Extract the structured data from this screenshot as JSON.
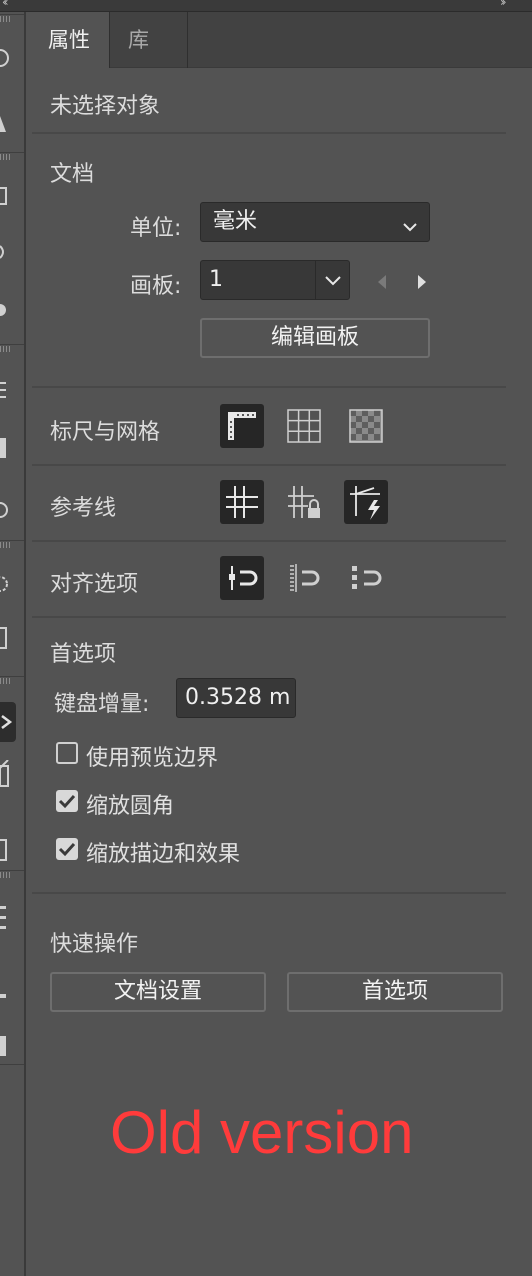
{
  "tabs": [
    {
      "label": "属性",
      "active": true
    },
    {
      "label": "库",
      "active": false
    }
  ],
  "selection_status": "未选择对象",
  "document": {
    "heading": "文档",
    "units_label": "单位:",
    "units_value": "毫米",
    "artboard_label": "画板:",
    "artboard_value": "1",
    "edit_artboards_button": "编辑画板"
  },
  "rulers_grids": {
    "label": "标尺与网格",
    "icons": [
      "ruler-icon",
      "grid-icon",
      "transparency-grid-icon"
    ],
    "active": [
      true,
      false,
      false
    ]
  },
  "guides": {
    "label": "参考线",
    "icons": [
      "guides-icon",
      "lock-guides-icon",
      "smart-guides-icon"
    ],
    "active": [
      true,
      false,
      true
    ]
  },
  "snap_options": {
    "label": "对齐选项",
    "icons": [
      "snap-to-point-icon",
      "snap-to-pixel-icon",
      "snap-to-glyph-icon"
    ],
    "active": [
      true,
      false,
      false
    ]
  },
  "preferences": {
    "heading": "首选项",
    "keyboard_increment_label": "键盘增量:",
    "keyboard_increment_value": "0.3528 m",
    "checkboxes": [
      {
        "label": "使用预览边界",
        "checked": false
      },
      {
        "label": "缩放圆角",
        "checked": true
      },
      {
        "label": "缩放描边和效果",
        "checked": true
      }
    ]
  },
  "quick_actions": {
    "heading": "快速操作",
    "document_setup_button": "文档设置",
    "preferences_button": "首选项"
  },
  "annotation": {
    "text": "Old version",
    "color": "#ff3b3b"
  },
  "colors": {
    "panel_bg": "#535353",
    "tab_bar_bg": "#424242",
    "field_bg": "#383838",
    "active_icon_bg": "#262626"
  }
}
